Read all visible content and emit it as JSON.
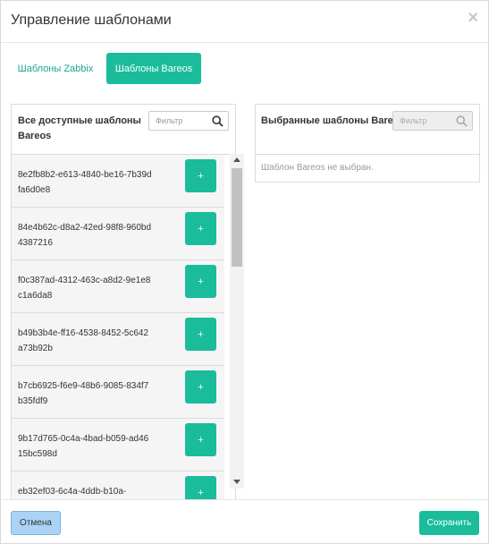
{
  "modal": {
    "title": "Управление шаблонами",
    "close_symbol": "×"
  },
  "tabs": [
    {
      "label": "Шаблоны Zabbix",
      "active": false
    },
    {
      "label": "Шаблоны Bareos",
      "active": true
    }
  ],
  "available": {
    "title": "Все доступные шаблоны Bareos",
    "filter_placeholder": "Фильтр",
    "filter_icon": "search-icon",
    "add_label": "+",
    "items": [
      "8e2fb8b2-e613-4840-be16-7b39dfa6d0e8",
      "84e4b62c-d8a2-42ed-98f8-960bd4387216",
      "f0c387ad-4312-463c-a8d2-9e1e8c1a6da8",
      "b49b3b4e-ff16-4538-8452-5c642a73b92b",
      "b7cb6925-f6e9-48b6-9085-834f7b35fdf9",
      "9b17d765-0c4a-4bad-b059-ad4615bc598d",
      "eb32ef03-6c4a-4ddb-b10a-"
    ]
  },
  "selected": {
    "title": "Выбранные шаблоны Bareos",
    "filter_placeholder": "Фильтр",
    "filter_icon": "search-icon",
    "empty_text": "Шаблон Bareos не выбран."
  },
  "footer": {
    "cancel_label": "Отмена",
    "save_label": "Сохранить"
  },
  "colors": {
    "accent": "#1abc9c",
    "cancel_bg": "#aad3f5"
  }
}
